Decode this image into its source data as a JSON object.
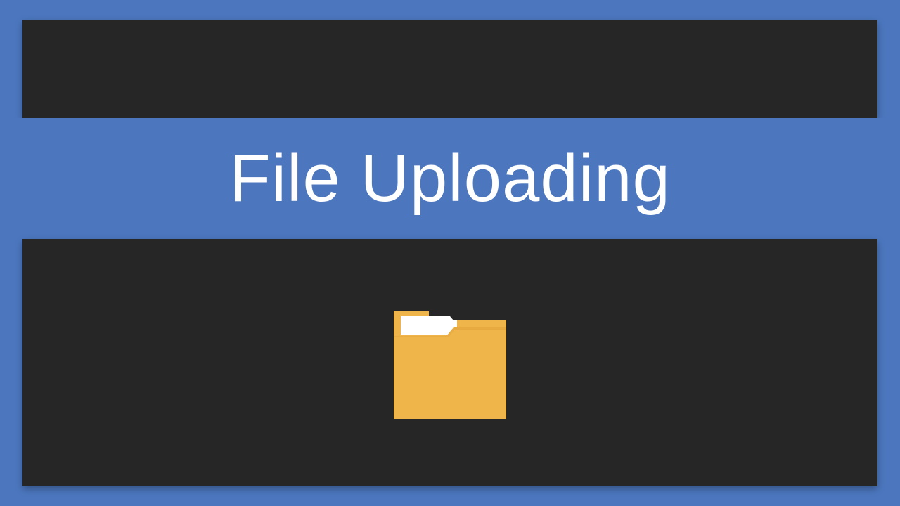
{
  "title": "File Uploading",
  "colors": {
    "background": "#4c77bf",
    "panel": "#262626",
    "title_text": "#ffffff",
    "folder_primary": "#efb54b",
    "folder_dark": "#e4a83e",
    "paper": "#ffffff"
  },
  "icon": "folder-with-paper-icon"
}
